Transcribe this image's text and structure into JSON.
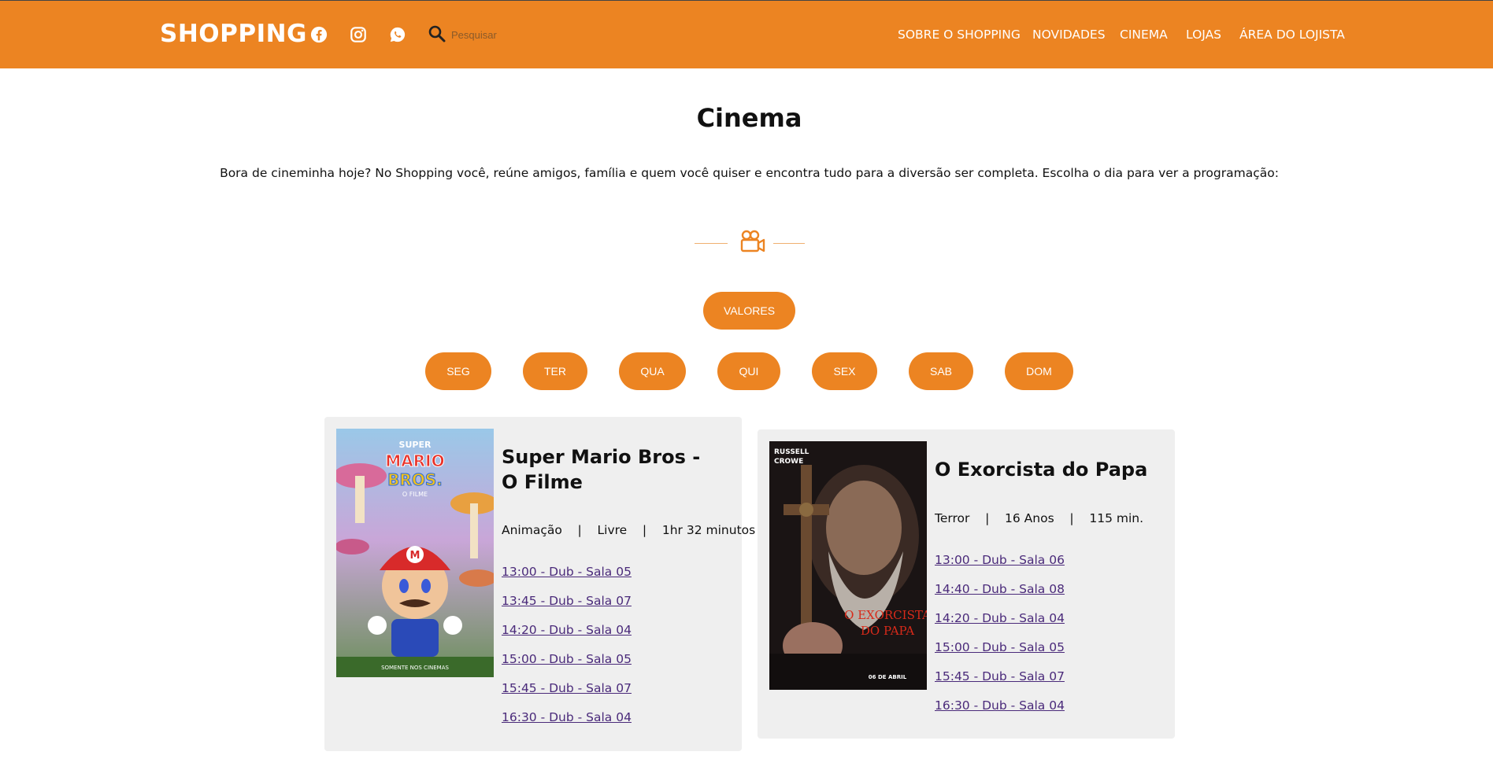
{
  "header": {
    "brand": "SHOPPING",
    "social": [
      "facebook-icon",
      "instagram-icon",
      "whatsapp-icon"
    ],
    "search": {
      "placeholder": "Pesquisar"
    },
    "nav": [
      "SOBRE O SHOPPING",
      "NOVIDADES",
      "CINEMA",
      "LOJAS",
      "ÁREA DO LOJISTA"
    ]
  },
  "main": {
    "title": "Cinema",
    "intro": "Bora de cineminha hoje? No Shopping você, reúne amigos, família e quem você quiser e encontra tudo para a diversão ser completa. Escolha o dia para ver a programação:",
    "divider_icon": "movie-camera-icon",
    "values_button": "VALORES",
    "days": [
      "SEG",
      "TER",
      "QUA",
      "QUI",
      "SEX",
      "SAB",
      "DOM"
    ]
  },
  "movies": [
    {
      "title": "Super Mario Bros - O Filme",
      "genre": "Animação",
      "rating": "Livre",
      "duration": "1hr 32 minutos",
      "poster_text": {
        "top": "SUPER",
        "main1": "MARIO",
        "main2": "BROS.",
        "sub": "O FILME",
        "bottom": "SOMENTE NOS CINEMAS"
      },
      "sessions": [
        "13:00 - Dub - Sala 05",
        "13:45 - Dub - Sala 07",
        "14:20 - Dub - Sala 04",
        "15:00 - Dub - Sala 05",
        "15:45 - Dub - Sala 07",
        "16:30 - Dub - Sala 04"
      ]
    },
    {
      "title": "O Exorcista do Papa",
      "genre": "Terror",
      "rating": "16 Anos",
      "duration": "115 min.",
      "poster_text": {
        "top1": "RUSSELL",
        "top2": "CROWE",
        "main1": "O EXORCISTA",
        "main2": "DO PAPA",
        "date": "06 DE ABRIL"
      },
      "sessions": [
        "13:00 - Dub - Sala 06",
        "14:40 - Dub - Sala 08",
        "14:20 - Dub - Sala 04",
        "15:00 - Dub - Sala 05",
        "15:45 - Dub - Sala 07",
        "16:30 - Dub - Sala 04"
      ]
    }
  ],
  "colors": {
    "accent": "#ec8422",
    "card_bg": "#efefef",
    "link": "#4a2a7a"
  }
}
